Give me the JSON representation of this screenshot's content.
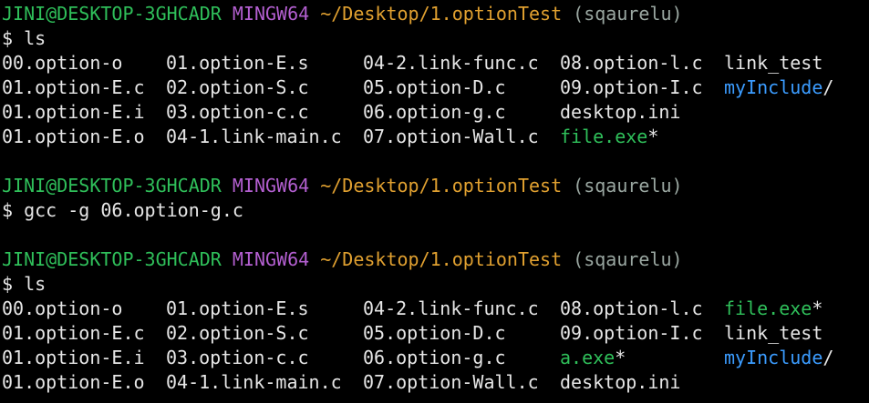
{
  "colors": {
    "user_host": "#2fbf5a",
    "mingw": "#b35fd0",
    "path": "#e0a030",
    "branch": "#9aa7a1",
    "text": "#e6e6e6",
    "dir": "#3b9cff",
    "exe": "#2fbf5a",
    "background": "#000000"
  },
  "prompt": {
    "user_host": "JINI@DESKTOP-3GHCADR",
    "env": "MINGW64",
    "path": "~/Desktop/1.optionTest",
    "branch": "(sqaurelu)",
    "symbol": "$"
  },
  "blocks": [
    {
      "command": "ls",
      "listing": [
        [
          {
            "name": "00.option-o",
            "type": "file"
          },
          {
            "name": "01.option-E.s",
            "type": "file"
          },
          {
            "name": "04-2.link-func.c",
            "type": "file"
          },
          {
            "name": "08.option-l.c",
            "type": "file"
          },
          {
            "name": "link_test",
            "type": "file"
          }
        ],
        [
          {
            "name": "01.option-E.c",
            "type": "file"
          },
          {
            "name": "02.option-S.c",
            "type": "file"
          },
          {
            "name": "05.option-D.c",
            "type": "file"
          },
          {
            "name": "09.option-I.c",
            "type": "file"
          },
          {
            "name": "myInclude",
            "type": "dir",
            "suffix": "/"
          }
        ],
        [
          {
            "name": "01.option-E.i",
            "type": "file"
          },
          {
            "name": "03.option-c.c",
            "type": "file"
          },
          {
            "name": "06.option-g.c",
            "type": "file"
          },
          {
            "name": "desktop.ini",
            "type": "file"
          }
        ],
        [
          {
            "name": "01.option-E.o",
            "type": "file"
          },
          {
            "name": "04-1.link-main.c",
            "type": "file"
          },
          {
            "name": "07.option-Wall.c",
            "type": "file"
          },
          {
            "name": "file.exe",
            "type": "exe",
            "suffix": "*"
          }
        ]
      ]
    },
    {
      "command": "gcc -g 06.option-g.c",
      "listing": []
    },
    {
      "command": "ls",
      "listing": [
        [
          {
            "name": "00.option-o",
            "type": "file"
          },
          {
            "name": "01.option-E.s",
            "type": "file"
          },
          {
            "name": "04-2.link-func.c",
            "type": "file"
          },
          {
            "name": "08.option-l.c",
            "type": "file"
          },
          {
            "name": "file.exe",
            "type": "exe",
            "suffix": "*"
          }
        ],
        [
          {
            "name": "01.option-E.c",
            "type": "file"
          },
          {
            "name": "02.option-S.c",
            "type": "file"
          },
          {
            "name": "05.option-D.c",
            "type": "file"
          },
          {
            "name": "09.option-I.c",
            "type": "file"
          },
          {
            "name": "link_test",
            "type": "file"
          }
        ],
        [
          {
            "name": "01.option-E.i",
            "type": "file"
          },
          {
            "name": "03.option-c.c",
            "type": "file"
          },
          {
            "name": "06.option-g.c",
            "type": "file"
          },
          {
            "name": "a.exe",
            "type": "exe",
            "suffix": "*"
          },
          {
            "name": "myInclude",
            "type": "dir",
            "suffix": "/"
          }
        ],
        [
          {
            "name": "01.option-E.o",
            "type": "file"
          },
          {
            "name": "04-1.link-main.c",
            "type": "file"
          },
          {
            "name": "07.option-Wall.c",
            "type": "file"
          },
          {
            "name": "desktop.ini",
            "type": "file"
          }
        ]
      ]
    }
  ]
}
